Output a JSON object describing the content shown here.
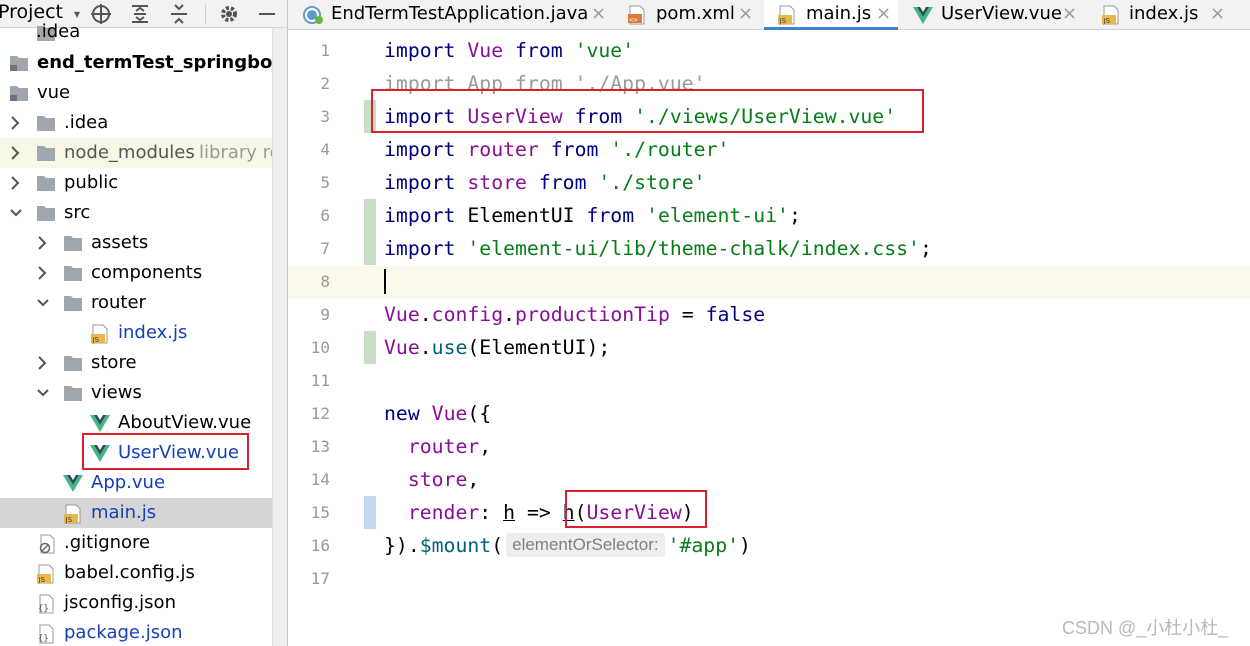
{
  "project_panel": {
    "title": "Project",
    "toolbar_icons": [
      "dropdown-caret-icon",
      "locate-icon",
      "expand-all-icon",
      "collapse-all-icon",
      "gear-icon",
      "minimize-icon"
    ],
    "tree": [
      {
        "label": ".idea",
        "type": "folder"
      },
      {
        "label": "end_termTest_springboot",
        "type": "module"
      },
      {
        "label": "vue",
        "type": "module"
      },
      {
        "label": ".idea",
        "type": "folder"
      },
      {
        "label": "node_modules",
        "suffix": "library root",
        "type": "folder"
      },
      {
        "label": "public",
        "type": "folder"
      },
      {
        "label": "src",
        "type": "folder"
      },
      {
        "label": "assets",
        "type": "folder"
      },
      {
        "label": "components",
        "type": "folder"
      },
      {
        "label": "router",
        "type": "folder"
      },
      {
        "label": "index.js",
        "type": "js"
      },
      {
        "label": "store",
        "type": "folder"
      },
      {
        "label": "views",
        "type": "folder"
      },
      {
        "label": "AboutView.vue",
        "type": "vue"
      },
      {
        "label": "UserView.vue",
        "type": "vue"
      },
      {
        "label": "App.vue",
        "type": "vue"
      },
      {
        "label": "main.js",
        "type": "js"
      },
      {
        "label": ".gitignore",
        "type": "ignore"
      },
      {
        "label": "babel.config.js",
        "type": "js"
      },
      {
        "label": "jsconfig.json",
        "type": "json"
      },
      {
        "label": "package.json",
        "type": "json"
      }
    ]
  },
  "tabs": [
    {
      "label": "EndTermTestApplication.java",
      "icon": "spring-boot-icon"
    },
    {
      "label": "pom.xml",
      "icon": "maven-icon"
    },
    {
      "label": "main.js",
      "icon": "js-file-icon",
      "active": true
    },
    {
      "label": "UserView.vue",
      "icon": "vue-icon"
    },
    {
      "label": "index.js",
      "icon": "js-file-icon"
    }
  ],
  "close_glyph": "×",
  "editor": {
    "line_numbers": [
      "1",
      "2",
      "3",
      "4",
      "5",
      "6",
      "7",
      "8",
      "9",
      "10",
      "11",
      "12",
      "13",
      "14",
      "15",
      "16",
      "17"
    ],
    "code": {
      "l1": [
        "import",
        " Vue ",
        "from",
        " 'vue'"
      ],
      "l2": "import App from './App.vue'",
      "l3": [
        "import",
        " UserView ",
        "from",
        " './views/UserView.vue'"
      ],
      "l4": [
        "import",
        " router ",
        "from",
        " './router'"
      ],
      "l5": [
        "import",
        " store ",
        "from",
        " './store'"
      ],
      "l6": [
        "import",
        " ElementUI ",
        "from",
        " 'element-ui'",
        ";"
      ],
      "l7": [
        "import",
        " 'element-ui/lib/theme-chalk/index.css'",
        ";"
      ],
      "l9": [
        "Vue",
        ".",
        "config",
        ".",
        "productionTip",
        " = ",
        "false"
      ],
      "l10": [
        "Vue",
        ".",
        "use",
        "(ElementUI);"
      ],
      "l12": [
        "new",
        " ",
        "Vue",
        "({"
      ],
      "l13": [
        "  router",
        ","
      ],
      "l14": [
        "  store",
        ","
      ],
      "l15": [
        "  render",
        ": ",
        "h",
        " => ",
        "h",
        "(",
        "UserView",
        ")"
      ],
      "l16": [
        "}).",
        "$mount",
        "(",
        "elementOrSelector:",
        "'#app'",
        ")"
      ]
    }
  },
  "colors": {
    "keyword": "#000080",
    "string": "#067d17",
    "identifier": "#871094",
    "highlight_box": "#d9202c",
    "vue_green": "#41b883",
    "folder": "#a0a6ad"
  },
  "watermark": "CSDN @_小杜小杜_"
}
